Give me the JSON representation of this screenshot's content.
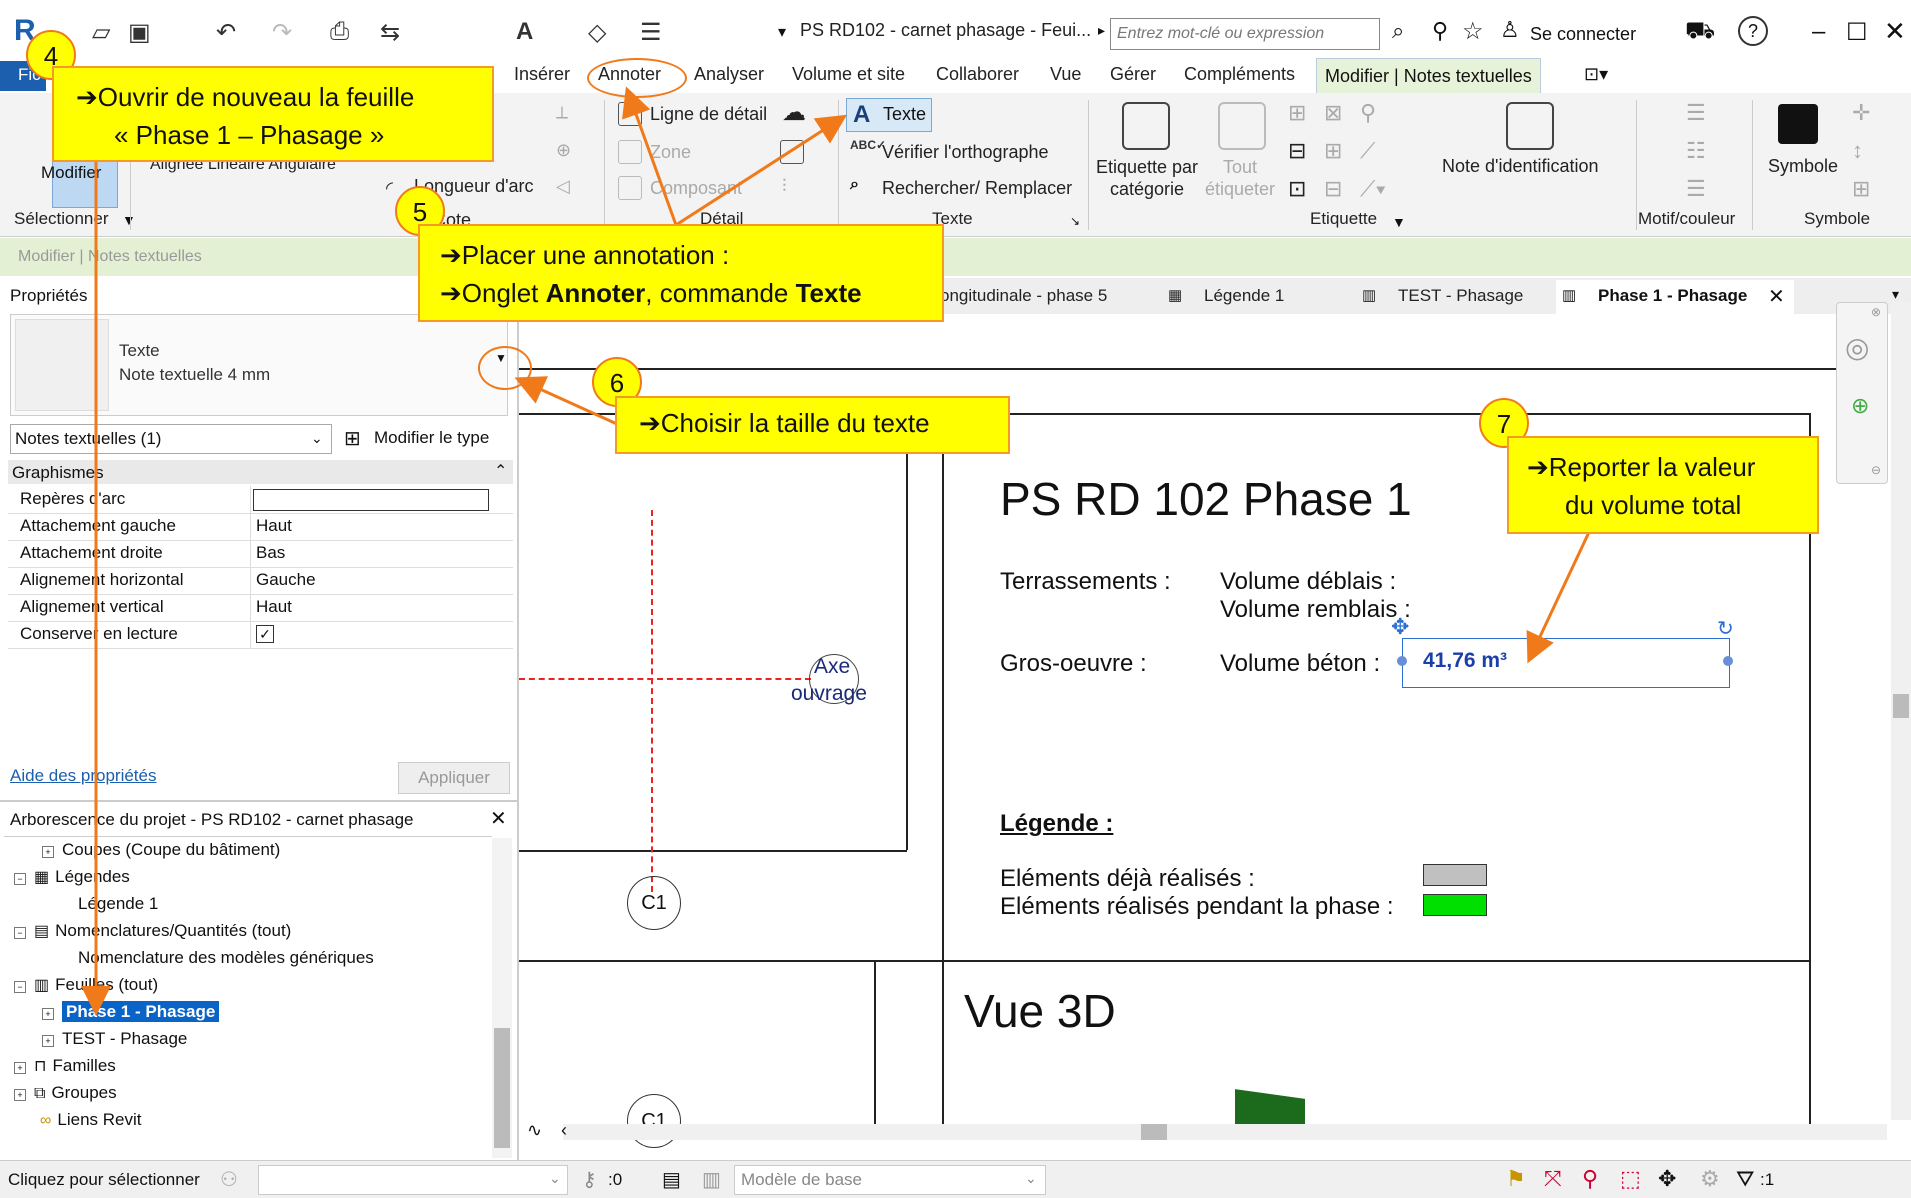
{
  "titlebar": {
    "app_initials": "R",
    "doc_title": "PS RD102 - carnet phasage  - Feui...",
    "search_placeholder": "Entrez mot-clé ou expression",
    "sign_in": "Se connecter",
    "help": "?"
  },
  "tabs": [
    "Fic",
    "Insérer",
    "Annoter",
    "Analyser",
    "Volume et site",
    "Collaborer",
    "Vue",
    "Gérer",
    "Compléments"
  ],
  "context_tab": "Modifier | Notes textuelles",
  "ribbon": {
    "modify": "Modifier",
    "align_labels": "Alignée  Linéaire  Angulaire",
    "arc_length": "Longueur d'arc",
    "cote": "Cote",
    "select": "Sélectionner",
    "detail_line": "Ligne de détail",
    "zone": "Zone",
    "component": "Composant",
    "detail": "Détail",
    "text": "Texte",
    "spell": "Vérifier  l'orthographe",
    "find_replace": "Rechercher/  Remplacer",
    "text_panel": "Texte",
    "tag_by_category": "Etiquette par catégorie",
    "tag_all": "Tout étiqueter",
    "keynote": "Note d'identification",
    "tag_panel": "Etiquette",
    "pattern_panel": "Motif/couleur",
    "symbol": "Symbole",
    "symbol_panel": "Symbole"
  },
  "context_bar": "Modifier | Notes textuelles",
  "properties": {
    "title": "Propriétés",
    "type_family": "Texte",
    "type_name": "Note textuelle 4 mm",
    "selector": "Notes textuelles (1)",
    "edit_type": "Modifier le type",
    "section": "Graphismes",
    "rows": [
      {
        "label": "Repères d'arc",
        "value": ""
      },
      {
        "label": "Attachement gauche",
        "value": "Haut"
      },
      {
        "label": "Attachement droite",
        "value": "Bas"
      },
      {
        "label": "Alignement horizontal",
        "value": "Gauche"
      },
      {
        "label": "Alignement vertical",
        "value": "Haut"
      },
      {
        "label": "Conserver en lecture",
        "value": ""
      }
    ],
    "help_link": "Aide des propriétés",
    "apply": "Appliquer"
  },
  "browser": {
    "title": "Arborescence du projet - PS RD102 - carnet phasage",
    "items": [
      "Coupes (Coupe du bâtiment)",
      "Légendes",
      "Légende 1",
      "Nomenclatures/Quantités (tout)",
      "Nomenclature des modèles génériques",
      "Feuilles (tout)",
      "Phase 1 - Phasage",
      "TEST - Phasage",
      "Familles",
      "Groupes",
      "Liens Revit"
    ]
  },
  "view_tabs": [
    "ongitudinale - phase 5",
    "Légende 1",
    "TEST - Phasage",
    "Phase 1 - Phasage"
  ],
  "sheet": {
    "axis_label_1": "Axe",
    "axis_label_2": "ouvrage",
    "grid_bubble_1": "C1",
    "grid_bubble_2": "C1",
    "title": "PS RD 102   Phase 1",
    "earthworks": "Terrassements :",
    "cut_volume": "Volume déblais :",
    "fill_volume": "Volume remblais :",
    "structure": "Gros-oeuvre :",
    "concrete_volume": "Volume béton :",
    "concrete_value": "41,76 m³",
    "legend_title": "Légende :",
    "legend_done": "Eléments déjà réalisés :",
    "legend_phase": "Eléments réalisés pendant la phase :",
    "view3d": "Vue 3D",
    "color_done": "#c0c0c0",
    "color_phase": "#00e000"
  },
  "status": {
    "hint": "Cliquez pour sélectionner",
    "zero": ":0",
    "model": "Modèle de base",
    "filter": ":1"
  },
  "callouts": {
    "n4": "4",
    "c4_line1": "➔Ouvrir de nouveau la feuille",
    "c4_line2": "« Phase 1 – Phasage »",
    "n5": "5",
    "c5_line1": "➔Placer une annotation :",
    "c5_line2_a": "➔Onglet ",
    "c5_line2_b": "Annoter",
    "c5_line2_c": ", commande ",
    "c5_line2_d": "Texte",
    "n6": "6",
    "c6": "➔Choisir la taille du texte",
    "n7": "7",
    "c7_line1": "➔Reporter la valeur",
    "c7_line2": "du volume total"
  },
  "colors": {
    "accent": "#f07a1a",
    "callout": "#ffff00",
    "selection": "#0a64c8"
  }
}
